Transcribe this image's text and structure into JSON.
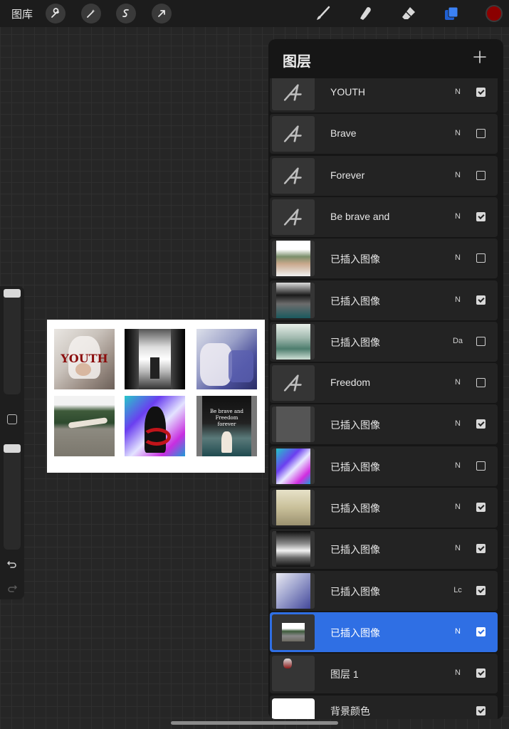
{
  "toolbar": {
    "gallery_label": "图库",
    "left_tools": [
      "wrench-icon",
      "magic-wand-icon",
      "selection-icon",
      "transform-arrow-icon"
    ],
    "right_tools": [
      "brush-icon",
      "smudge-icon",
      "eraser-icon",
      "layers-icon"
    ],
    "active_color": "#8b0000",
    "accent": "#2f6fe4"
  },
  "artwork": {
    "tile_text_youth": "YOUTH",
    "tile_text_quote": "Be brave and Freedom forever"
  },
  "layers_panel": {
    "title": "图层",
    "add_icon": "plus-icon",
    "layers": [
      {
        "name": "YOUTH",
        "mode": "N",
        "visible": true,
        "kind": "text"
      },
      {
        "name": "Brave",
        "mode": "N",
        "visible": false,
        "kind": "text"
      },
      {
        "name": "Forever",
        "mode": "N",
        "visible": false,
        "kind": "text"
      },
      {
        "name": "Be brave and",
        "mode": "N",
        "visible": true,
        "kind": "text"
      },
      {
        "name": "已插入图像",
        "mode": "N",
        "visible": false,
        "kind": "image"
      },
      {
        "name": "已插入图像",
        "mode": "N",
        "visible": true,
        "kind": "image"
      },
      {
        "name": "已插入图像",
        "mode": "Da",
        "visible": false,
        "kind": "image"
      },
      {
        "name": "Freedom",
        "mode": "N",
        "visible": false,
        "kind": "text"
      },
      {
        "name": "已插入图像",
        "mode": "N",
        "visible": true,
        "kind": "image"
      },
      {
        "name": "已插入图像",
        "mode": "N",
        "visible": false,
        "kind": "image"
      },
      {
        "name": "已插入图像",
        "mode": "N",
        "visible": true,
        "kind": "image"
      },
      {
        "name": "已插入图像",
        "mode": "N",
        "visible": true,
        "kind": "image"
      },
      {
        "name": "已插入图像",
        "mode": "Lc",
        "visible": true,
        "kind": "image"
      },
      {
        "name": "已插入图像",
        "mode": "N",
        "visible": true,
        "kind": "image",
        "selected": true
      },
      {
        "name": "图层 1",
        "mode": "N",
        "visible": true,
        "kind": "paint"
      },
      {
        "name": "背景颜色",
        "mode": "",
        "visible": true,
        "kind": "background"
      }
    ]
  }
}
